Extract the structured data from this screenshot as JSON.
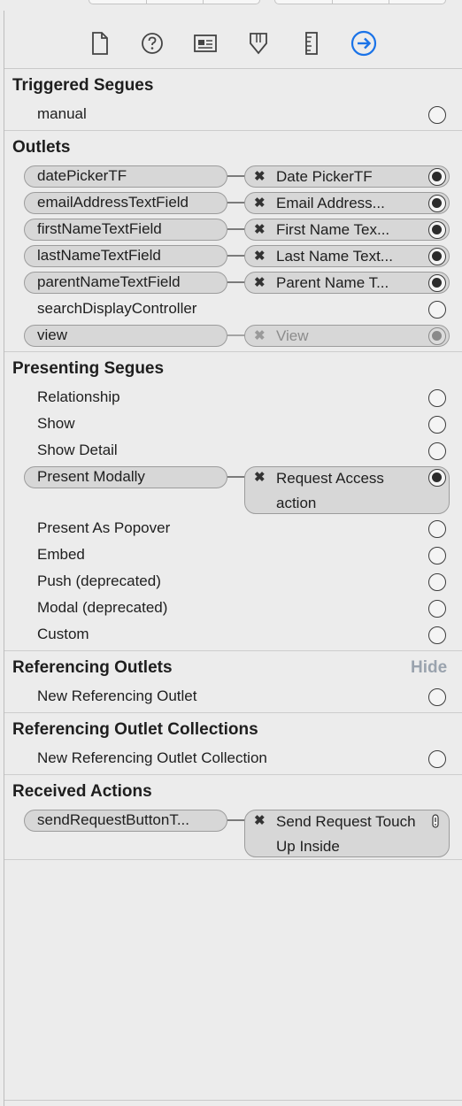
{
  "toolbar": {
    "icons": [
      "file-inspector-icon",
      "quick-help-icon",
      "identity-inspector-icon",
      "attributes-inspector-icon",
      "size-inspector-icon",
      "connections-inspector-icon"
    ],
    "active_color": "#1a73e8"
  },
  "triggered_segues": {
    "title": "Triggered Segues",
    "items": [
      {
        "label": "manual"
      }
    ]
  },
  "outlets": {
    "title": "Outlets",
    "items": [
      {
        "label": "datePickerTF",
        "target": "Date PickerTF",
        "connected": true
      },
      {
        "label": "emailAddressTextField",
        "target": "Email Address...",
        "connected": true
      },
      {
        "label": "firstNameTextField",
        "target": "First Name Tex...",
        "connected": true
      },
      {
        "label": "lastNameTextField",
        "target": "Last Name Text...",
        "connected": true
      },
      {
        "label": "parentNameTextField",
        "target": "Parent Name T...",
        "connected": true
      },
      {
        "label": "searchDisplayController",
        "target": "",
        "connected": false
      },
      {
        "label": "view",
        "target": "View",
        "connected": true,
        "dimmed": true
      }
    ]
  },
  "presenting_segues": {
    "title": "Presenting Segues",
    "items": [
      {
        "label": "Relationship"
      },
      {
        "label": "Show"
      },
      {
        "label": "Show Detail"
      },
      {
        "label": "Present Modally",
        "target": "Request Access action"
      },
      {
        "label": "Present As Popover"
      },
      {
        "label": "Embed"
      },
      {
        "label": "Push (deprecated)"
      },
      {
        "label": "Modal (deprecated)"
      },
      {
        "label": "Custom"
      }
    ]
  },
  "referencing_outlets": {
    "title": "Referencing Outlets",
    "hide_label": "Hide",
    "items": [
      {
        "label": "New Referencing Outlet"
      }
    ]
  },
  "referencing_outlet_collections": {
    "title": "Referencing Outlet Collections",
    "items": [
      {
        "label": "New Referencing Outlet Collection"
      }
    ]
  },
  "received_actions": {
    "title": "Received Actions",
    "items": [
      {
        "label": "sendRequestButtonT...",
        "target": "Send Request Touch Up Inside"
      }
    ]
  }
}
